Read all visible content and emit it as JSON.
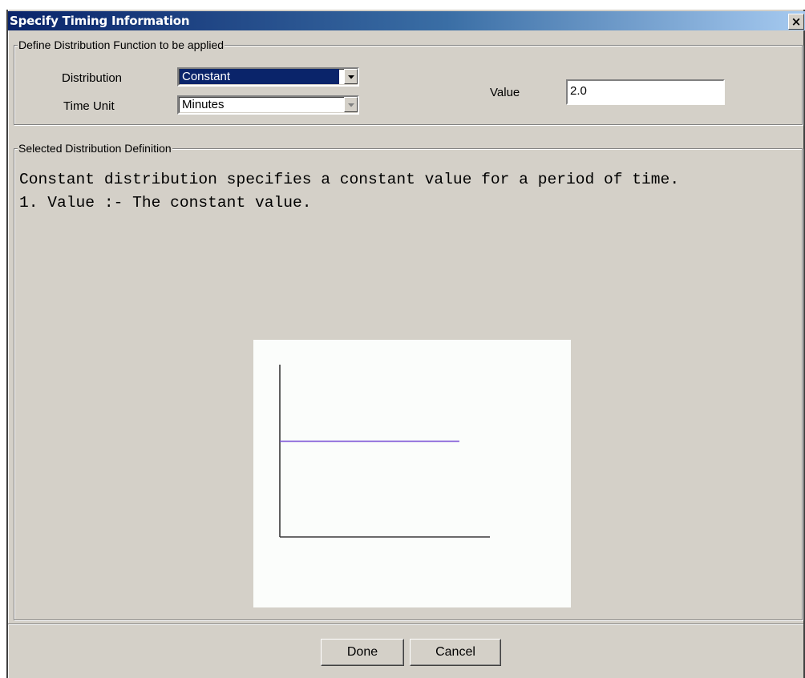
{
  "window": {
    "title": "Specify Timing Information",
    "close_label": "×"
  },
  "distribution_group": {
    "legend": "Define Distribution Function to be applied",
    "distribution_label": "Distribution",
    "distribution_value": "Constant",
    "time_unit_label": "Time Unit",
    "time_unit_value": "Minutes",
    "value_label": "Value",
    "value_input": "2.0"
  },
  "definition_group": {
    "legend": "Selected Distribution Definition",
    "line1": "Constant distribution specifies a constant value for a period of time.",
    "line2": "1. Value :- The constant value."
  },
  "chart_data": {
    "type": "line",
    "title": "",
    "xlabel": "",
    "ylabel": "",
    "series": [
      {
        "x": [
          0,
          1
        ],
        "y": [
          1,
          1
        ]
      }
    ],
    "xlim": [
      0,
      1.17
    ],
    "ylim": [
      0,
      1.8
    ],
    "grid": false,
    "line_color": "#7b52d6",
    "axis_color": "#3a3a3a"
  },
  "buttons": {
    "done": "Done",
    "cancel": "Cancel"
  }
}
